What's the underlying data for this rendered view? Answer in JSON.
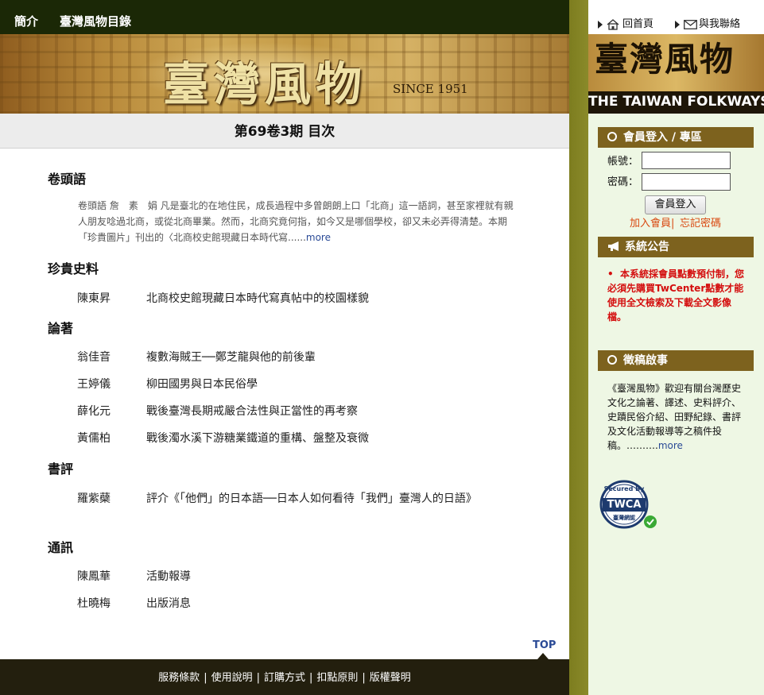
{
  "nav": {
    "items": [
      "簡介",
      "臺灣風物目錄"
    ]
  },
  "banner": {
    "title": "臺灣風物",
    "since": "SINCE 1951"
  },
  "issue": {
    "title": "第69卷3期 目次"
  },
  "toc": {
    "intro_heading": "卷頭語",
    "intro_text": "卷頭語 詹　素　娟 凡是臺北的在地住民，成長過程中多曾朗朗上口「北商」這一語詞，甚至家裡就有親人朋友唸過北商，或從北商畢業。然而，北商究竟何指，如今又是哪個學校，卻又未必弄得清楚。本期「珍貴圖片」刊出的〈北商校史館現藏日本時代寫......",
    "more": "more",
    "sections": [
      {
        "heading": "珍貴史料",
        "articles": [
          {
            "author": "陳東昇",
            "title": "北商校史館現藏日本時代寫真帖中的校園樣貌"
          }
        ]
      },
      {
        "heading": "論著",
        "articles": [
          {
            "author": "翁佳音",
            "title": "複數海賊王──鄭芝龍與他的前後輩"
          },
          {
            "author": "王婷儀",
            "title": "柳田國男與日本民俗學"
          },
          {
            "author": "薛化元",
            "title": "戰後臺灣長期戒嚴合法性與正當性的再考察"
          },
          {
            "author": "黃儒柏",
            "title": "戰後濁水溪下游糖業鐵道的重構、盤整及衰微"
          }
        ]
      },
      {
        "heading": "書評",
        "articles": [
          {
            "author": "羅紫蘗",
            "title": "評介《「他們」的日本語──日本人如何看待「我們」臺灣人的日語》"
          }
        ]
      },
      {
        "heading": "通訊",
        "articles": [
          {
            "author": "陳鳳華",
            "title": "活動報導"
          },
          {
            "author": "杜曉梅",
            "title": "出版消息"
          }
        ]
      }
    ]
  },
  "top_label": "TOP",
  "footer": {
    "links": [
      "服務條款",
      "使用說明",
      "訂購方式",
      "扣點原則",
      "版權聲明"
    ]
  },
  "sidebar": {
    "home": "回首頁",
    "contact": "與我聯絡",
    "logo_title": "臺灣風物",
    "logo_en": "THE TAIWAN FOLKWAYS",
    "login": {
      "heading": "會員登入 / 專區",
      "account_label": "帳號：",
      "password_label": "密碼：",
      "button": "會員登入",
      "join": "加入會員",
      "forgot": "忘記密碼"
    },
    "notice": {
      "heading": "系統公告",
      "text": "本系統採會員點數預付制，您必須先購買TwCenter點數才能使用全文檢索及下載全文影像檔。"
    },
    "solicit": {
      "heading": "徵稿啟事",
      "text": "《臺灣風物》歡迎有關台灣歷史文化之論著、譯述、史料評介、史蹟民俗介紹、田野紀錄、書評及文化活動報導等之稿件投稿。……….",
      "more": "more"
    },
    "badge": {
      "top": "Secured By",
      "mid": "TWCA",
      "bottom": "臺灣網認"
    },
    "colors": {
      "header_bg": "#7d621e",
      "notice_red": "#d40e0e",
      "link_orange": "#d9480f",
      "nav_bg": "#1b2806"
    }
  }
}
